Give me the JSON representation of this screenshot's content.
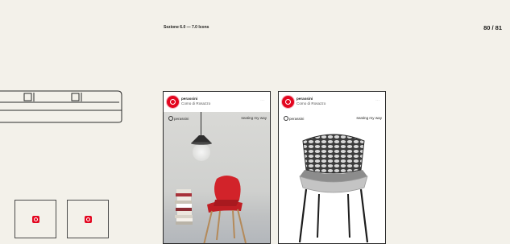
{
  "header": {
    "section": "Sezione 6.0 — 7.0 Icons",
    "page": "80 / 81"
  },
  "posts": [
    {
      "account_name": "perassini",
      "location": "Como di Rosazzo",
      "more": "···",
      "brand": "perassini",
      "tagline": "seating my way"
    },
    {
      "account_name": "perassini",
      "location": "Como di Rosazzo",
      "more": "···",
      "brand": "perassini",
      "tagline": "seating my way"
    }
  ],
  "colors": {
    "background": "#f3f1ea",
    "brand_red": "#e3061f",
    "chair_red": "#d2232a",
    "outline": "#2a2a2a"
  },
  "icons": [
    "perassini-logo-icon",
    "more-options-icon",
    "perassini-brand-icon"
  ]
}
